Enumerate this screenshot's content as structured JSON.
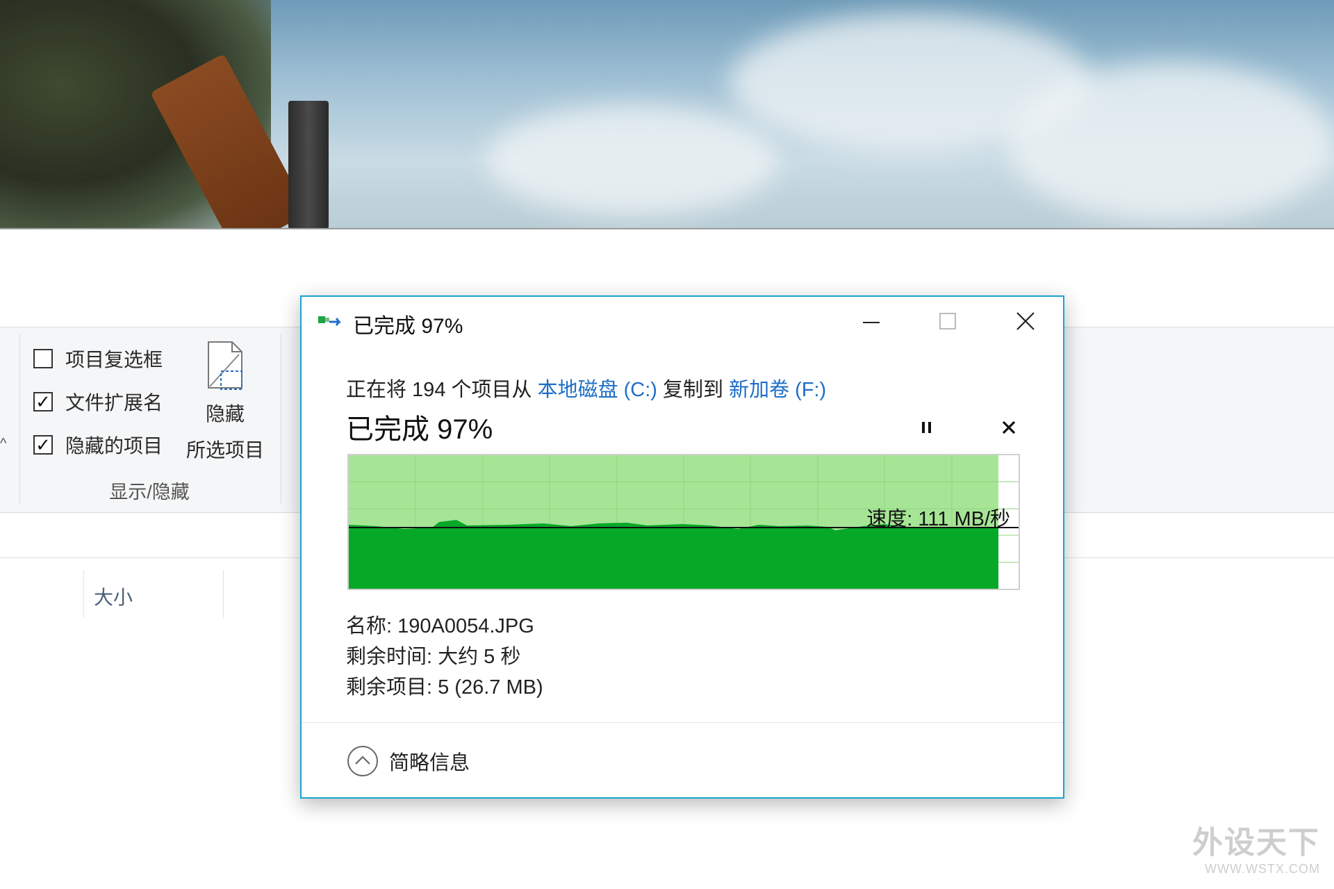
{
  "ribbon": {
    "show_hide_group": {
      "label": "显示/隐藏",
      "checkboxes": [
        {
          "label": "项目复选框",
          "checked": false
        },
        {
          "label": "文件扩展名",
          "checked": true
        },
        {
          "label": "隐藏的项目",
          "checked": true
        }
      ],
      "hide_selected_line1": "隐藏",
      "hide_selected_line2": "所选项目"
    }
  },
  "file_list": {
    "column_size": "大小"
  },
  "dialog": {
    "title": "已完成 97%",
    "copy_prefix": "正在将 194 个项目从 ",
    "source": "本地磁盘 (C:)",
    "copy_mid": " 复制到 ",
    "destination": "新加卷 (F:)",
    "progress_text": "已完成 97%",
    "progress_fraction": 0.97,
    "speed_text": "速度: 111 MB/秒",
    "name_line": "名称: 190A0054.JPG",
    "time_line": "剩余时间: 大约 5 秒",
    "items_line": "剩余项目: 5 (26.7 MB)",
    "more_info": "简略信息",
    "colors": {
      "border": "#1aa3cf",
      "link": "#1e6ec8",
      "graph_fill": "#06a828",
      "graph_done_bg": "#a6e596",
      "graph_grid": "#8fd67d"
    }
  },
  "watermark": {
    "cn": "外设天下",
    "en": "WWW.WSTX.COM"
  }
}
